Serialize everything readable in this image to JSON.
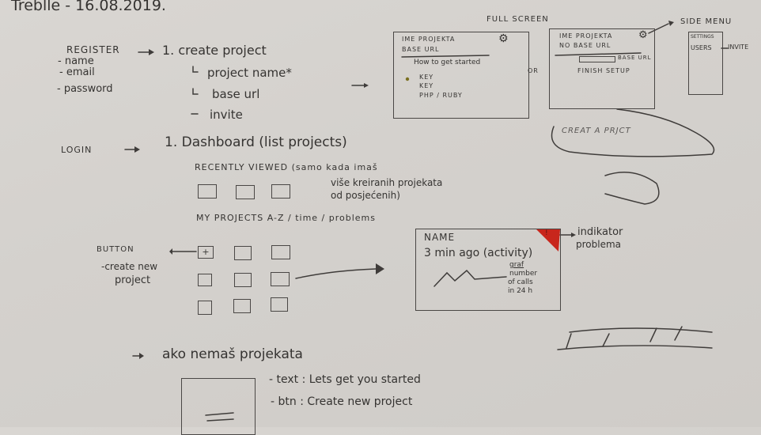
{
  "header": {
    "title": "Treblle - 16.08.2019."
  },
  "register": {
    "label": "REGISTER",
    "fields": [
      "- name",
      "- email",
      "- password"
    ],
    "step": "1. create project",
    "substeps": [
      "project name*",
      "base url",
      "invite"
    ]
  },
  "fullscreen": {
    "label": "FULL SCREEN",
    "box1": {
      "line1": "IME PROJEKTA",
      "line2": "BASE URL",
      "howto": "How to get started",
      "items": [
        "KEY",
        "KEY",
        "PHP / RUBY"
      ]
    },
    "or": "OR",
    "box2": {
      "line1": "IME PROJEKTA",
      "line2": "NO BASE URL",
      "input_label": "BASE URL",
      "finish": "FINISH SETUP"
    }
  },
  "side_menu": {
    "label": "SIDE MENU",
    "items": [
      "SETTINGS",
      "USERS"
    ],
    "invite": "INVITE"
  },
  "doodle": {
    "text": "CREAT A PRJCT"
  },
  "login": {
    "label": "LOGIN",
    "step": "1. Dashboard (list projects)",
    "recently_viewed": "RECENTLY VIEWED (samo kada imaš",
    "recently_note": [
      "više kreiranih projekata",
      "od posjećenih)"
    ],
    "my_projects": "MY PROJECTS  A-Z / time / problems",
    "button_note": [
      "BUTTON",
      "-create new",
      "project"
    ],
    "plus": "+"
  },
  "project_card": {
    "name": "NAME",
    "activity": "3 min ago (activity)",
    "graf_label": "graf",
    "graf_note": [
      "number",
      "of calls",
      "in 24 h"
    ],
    "problem_indicator": "!",
    "indicator_note": [
      "indikator",
      "problema"
    ],
    "indicator_color": "#c8261c"
  },
  "empty_state": {
    "heading": "ako nemaš projekata",
    "notes": [
      "- text : Lets get you started",
      "- btn : Create new project"
    ]
  }
}
